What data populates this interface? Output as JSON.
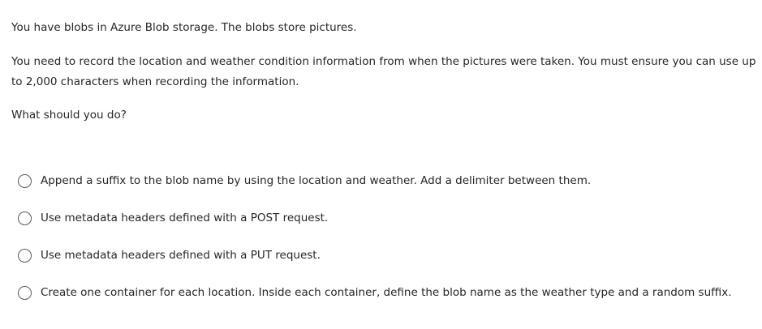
{
  "question": {
    "paragraphs": [
      "You have blobs in Azure Blob storage. The blobs store pictures.",
      "You need to record the location and weather condition information from when the pictures were taken. You must ensure you can use up to 2,000 characters when recording the information.",
      "What should you do?"
    ]
  },
  "options": [
    {
      "label": "Append a suffix to the blob name by using the location and weather. Add a delimiter between them.",
      "selected": false
    },
    {
      "label": "Use metadata headers defined with a POST request.",
      "selected": false
    },
    {
      "label": "Use metadata headers defined with a PUT request.",
      "selected": false
    },
    {
      "label": "Create one container for each location. Inside each container, define the blob name as the weather type and a random suffix.",
      "selected": false
    }
  ]
}
